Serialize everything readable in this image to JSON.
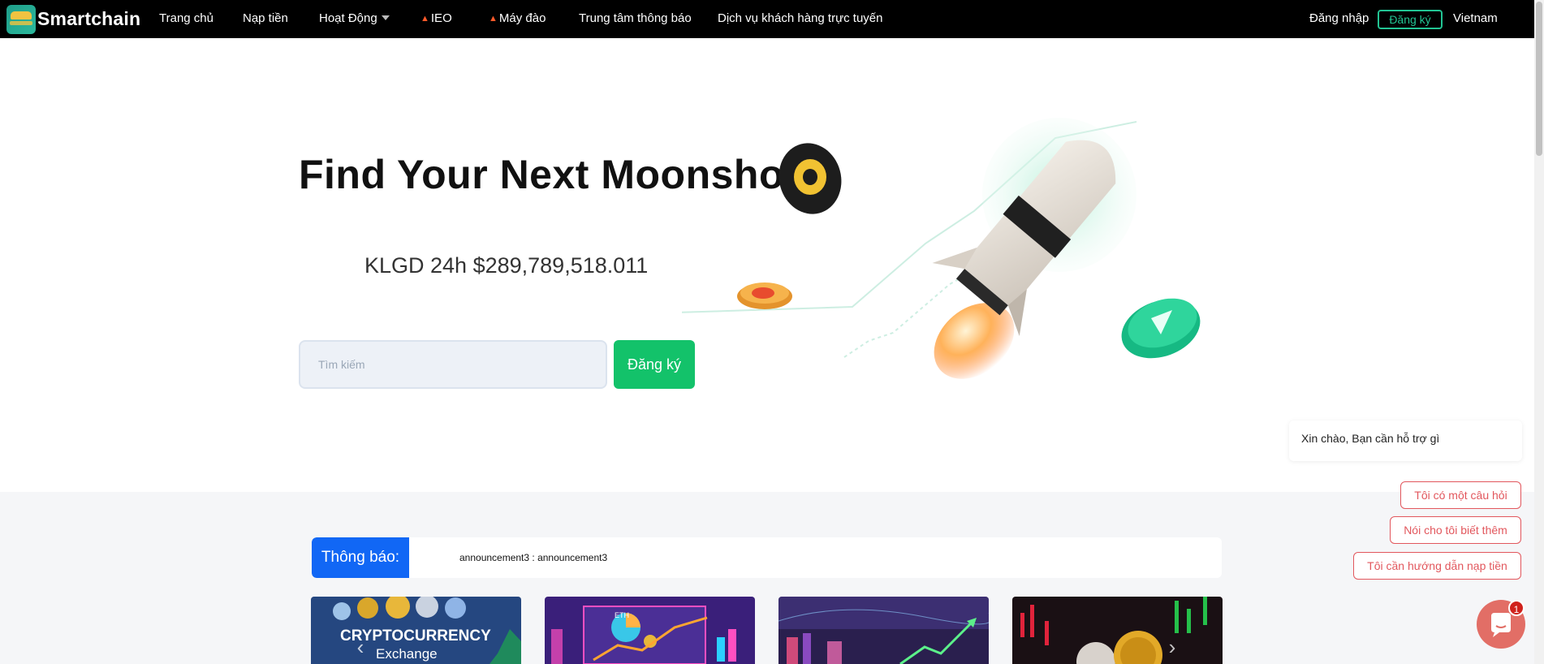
{
  "header": {
    "brand": "Smartchain",
    "nav": {
      "home": "Trang chủ",
      "deposit": "Nạp tiền",
      "activities": "Hoạt Động",
      "ieo": "IEO",
      "miner": "Máy đào",
      "notification_center": "Trung tâm thông báo",
      "customer_service": "Dịch vụ khách hàng trực tuyến"
    },
    "login": "Đăng nhập",
    "register": "Đăng ký",
    "language": "Vietnam"
  },
  "hero": {
    "title": "Find Your Next Moonshot",
    "volume": "KLGD 24h $289,789,518.011",
    "search_placeholder": "Tìm kiếm",
    "register_button": "Đăng ký"
  },
  "notice": {
    "label": "Thông báo:",
    "text": "announcement3 : announcement3"
  },
  "banners": {
    "card1_line1": "CRYPTOCURRENCY",
    "card1_line2": "Exchange",
    "card2_text": "ETH"
  },
  "chat": {
    "greeting": "Xin chào, Bạn cần hỗ trợ gì",
    "options": [
      "Tôi có một câu hỏi",
      "Nói cho tôi biết thêm",
      "Tôi cần hướng dẫn nạp tiền"
    ],
    "badge": "1"
  },
  "colors": {
    "accent_green": "#13c26a",
    "outline_green": "#22c493",
    "notice_blue": "#1167f5",
    "chat_red": "#e2575d"
  }
}
